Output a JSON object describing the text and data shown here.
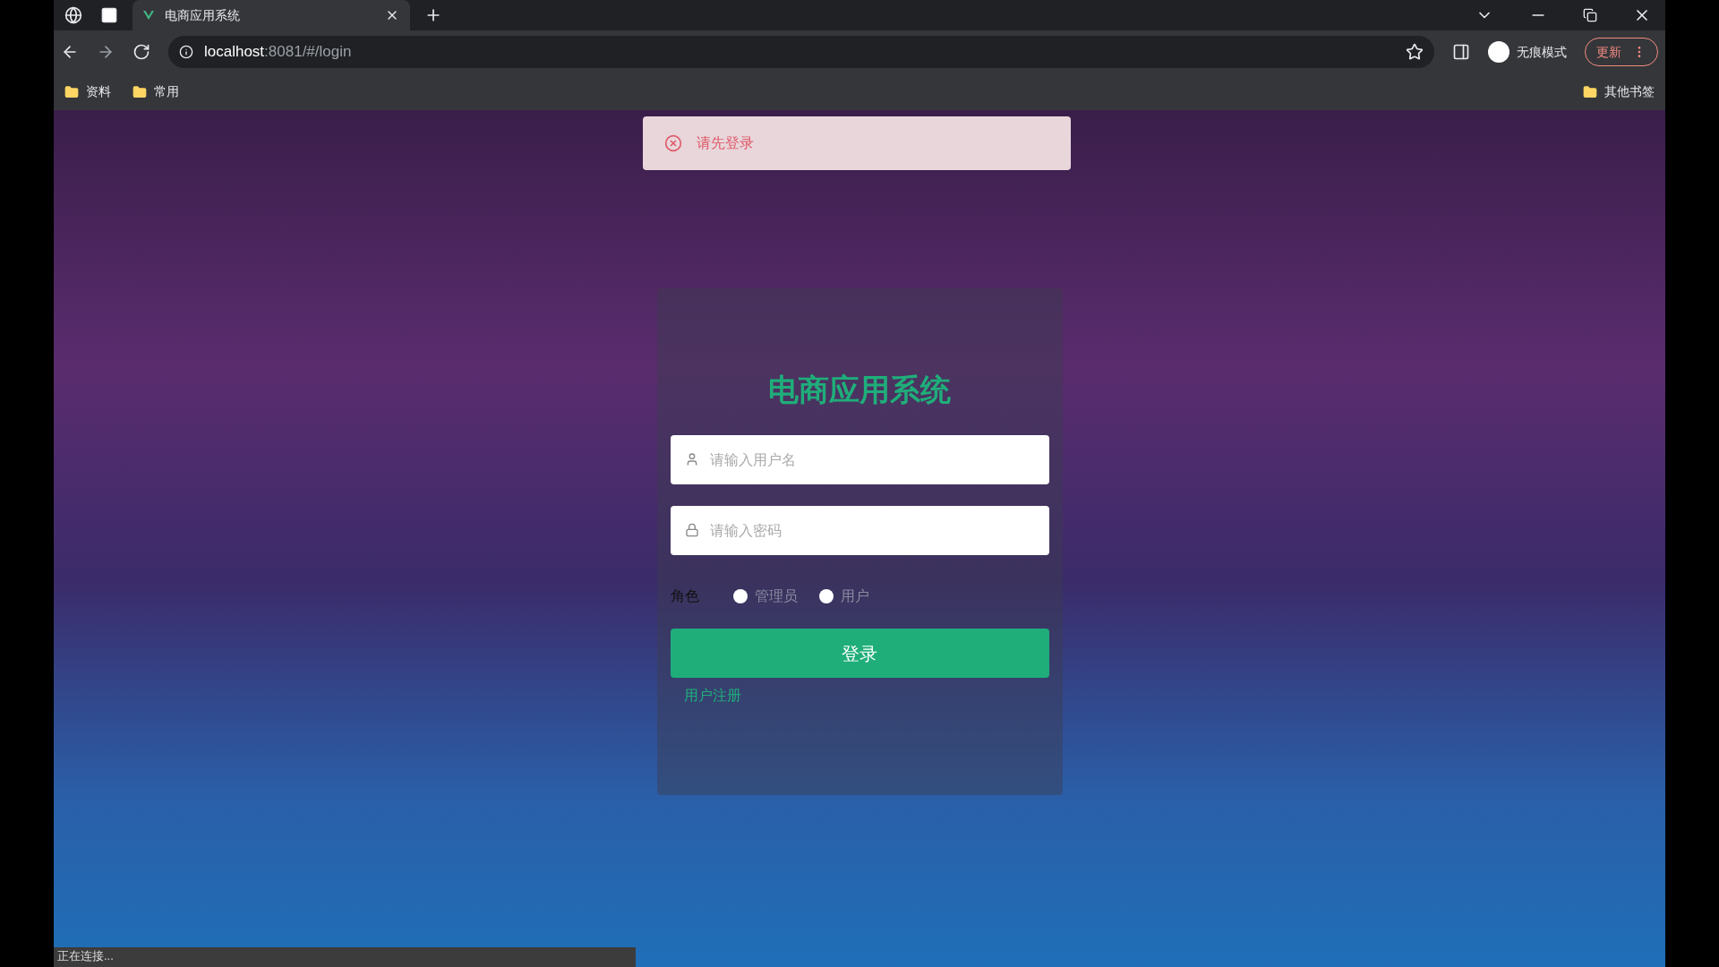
{
  "browser": {
    "tabs": [
      {
        "title": "电商应用系统",
        "selected": true
      }
    ],
    "address": {
      "host": "localhost",
      "rest": ":8081/#/login"
    },
    "profile_label": "无痕模式",
    "update_button": "更新",
    "bookmarks": [
      "资料",
      "常用"
    ],
    "other_bookmarks": "其他书签",
    "status_text": "正在连接..."
  },
  "message": {
    "kind": "error",
    "text": "请先登录"
  },
  "login": {
    "title": "电商应用系统",
    "username": {
      "placeholder": "请输入用户名"
    },
    "password": {
      "placeholder": "请输入密码"
    },
    "role_label": "角色",
    "roles": [
      {
        "label": "管理员",
        "selected": false
      },
      {
        "label": "用户",
        "selected": false
      }
    ],
    "submit": "登录",
    "register_link": "用户注册"
  }
}
